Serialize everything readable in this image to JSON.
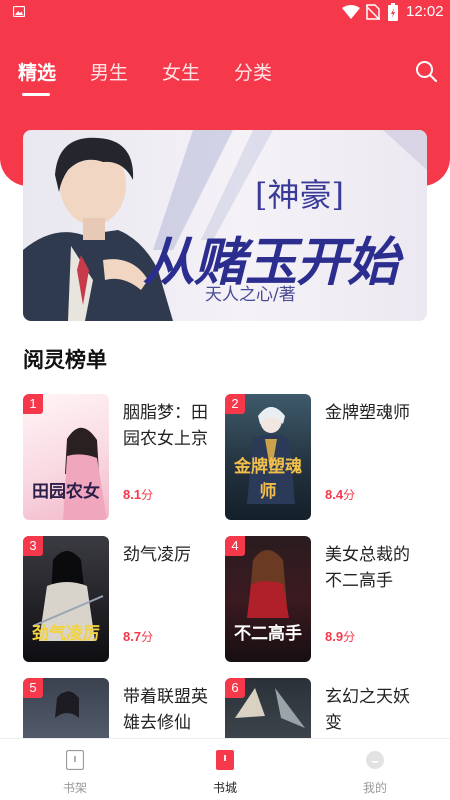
{
  "status_bar": {
    "time": "12:02",
    "icons": [
      "image-icon",
      "wifi-icon",
      "no-sim-icon",
      "battery-charging-icon"
    ]
  },
  "tabs": [
    {
      "label": "精选",
      "active": true
    },
    {
      "label": "男生",
      "active": false
    },
    {
      "label": "女生",
      "active": false
    },
    {
      "label": "分类",
      "active": false
    }
  ],
  "banner": {
    "tag": "[神豪]",
    "title": "从赌玉开始",
    "author": "天人之心/著"
  },
  "ranking": {
    "title": "阅灵榜单",
    "books": [
      {
        "rank": "1",
        "title": "胭脂梦：田园农女上京",
        "score": "8.1",
        "unit": "分",
        "cover_text": "田园农女"
      },
      {
        "rank": "2",
        "title": "金牌塑魂师",
        "score": "8.4",
        "unit": "分",
        "cover_text": "金牌塑魂师"
      },
      {
        "rank": "3",
        "title": "劲气凌厉",
        "score": "8.7",
        "unit": "分",
        "cover_text": "劲气凌厉"
      },
      {
        "rank": "4",
        "title": "美女总裁的不二高手",
        "score": "8.9",
        "unit": "分",
        "cover_text": "不二高手"
      },
      {
        "rank": "5",
        "title": "带着联盟英雄去修仙",
        "score": "",
        "unit": "",
        "cover_text": ""
      },
      {
        "rank": "6",
        "title": "玄幻之天妖变",
        "score": "",
        "unit": "",
        "cover_text": ""
      }
    ]
  },
  "bottom_nav": [
    {
      "label": "书架",
      "icon": "bookshelf-icon",
      "active": false
    },
    {
      "label": "书城",
      "icon": "bookstore-icon",
      "active": true
    },
    {
      "label": "我的",
      "icon": "profile-icon",
      "active": false
    }
  ],
  "colors": {
    "brand_red": "#f5394b",
    "white": "#ffffff"
  }
}
